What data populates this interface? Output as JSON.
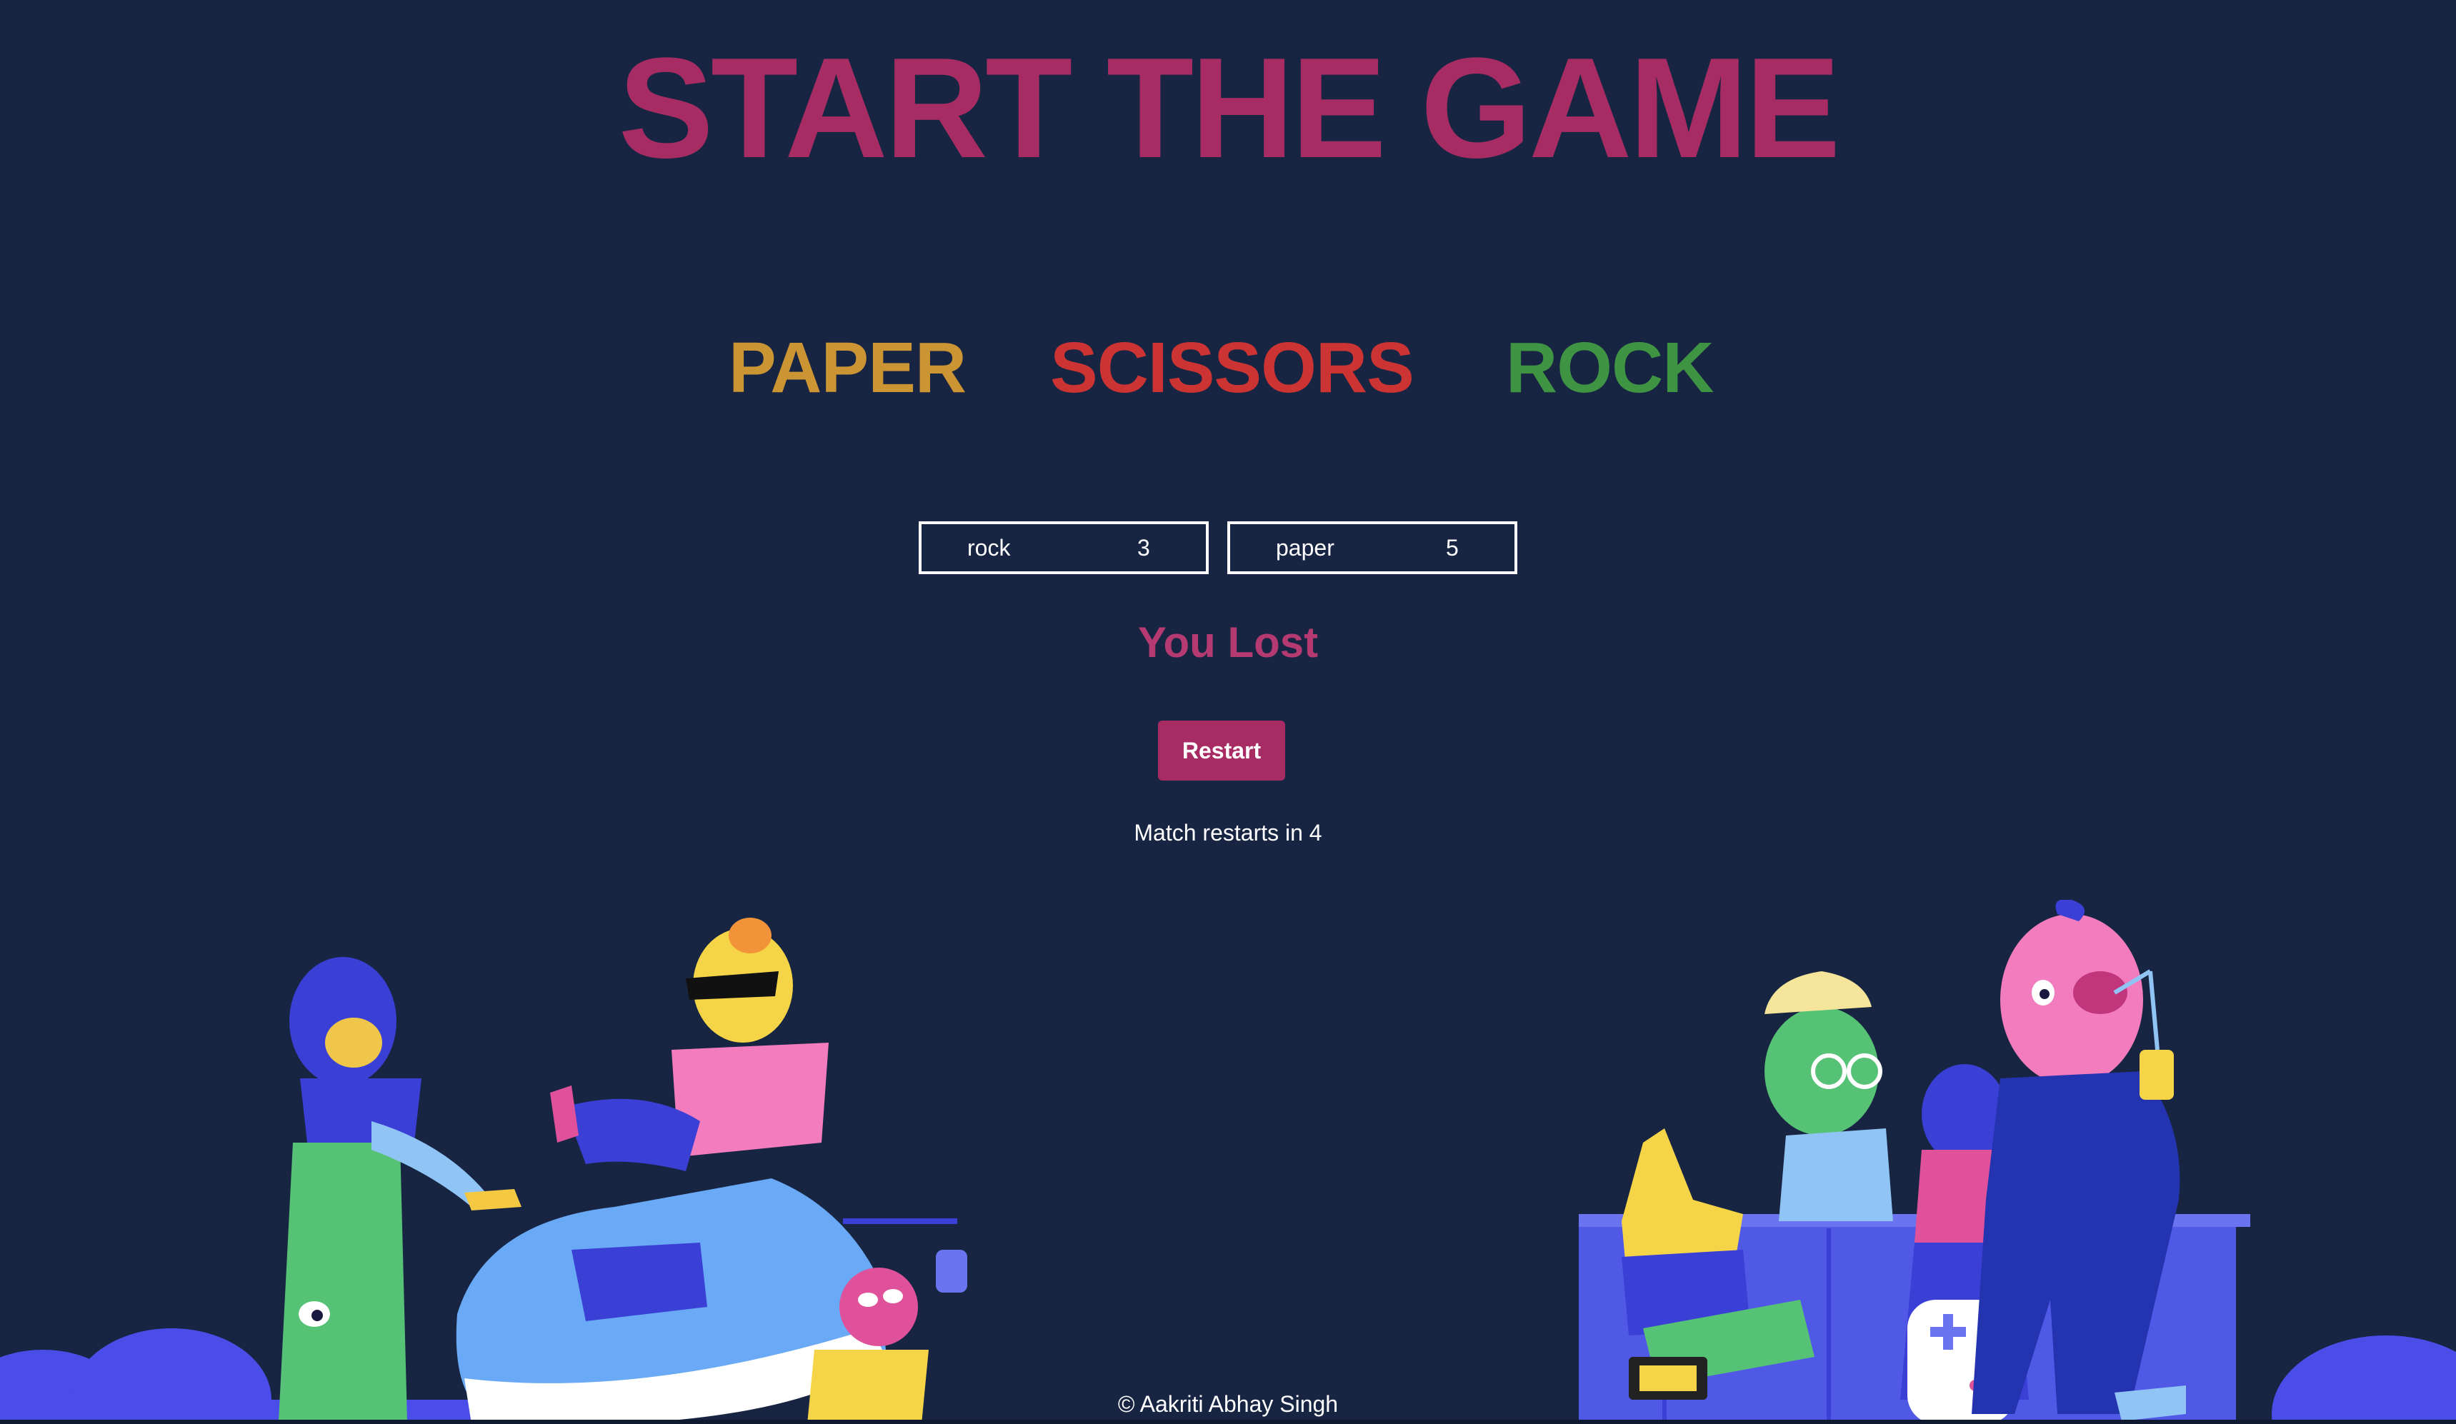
{
  "title": "START THE GAME",
  "choices": [
    {
      "label": "PAPER",
      "color": "#cc9533"
    },
    {
      "label": "SCISSORS",
      "color": "#cc3333"
    },
    {
      "label": "ROCK",
      "color": "#3f9444"
    }
  ],
  "scores": {
    "player": {
      "choice": "rock",
      "value": "3"
    },
    "computer": {
      "choice": "paper",
      "value": "5"
    }
  },
  "result": "You Lost",
  "restart_label": "Restart",
  "countdown": "Match restarts in 4",
  "footer": "© Aakriti Abhay Singh",
  "colors": {
    "background": "#182542",
    "accent": "#a82c64"
  }
}
